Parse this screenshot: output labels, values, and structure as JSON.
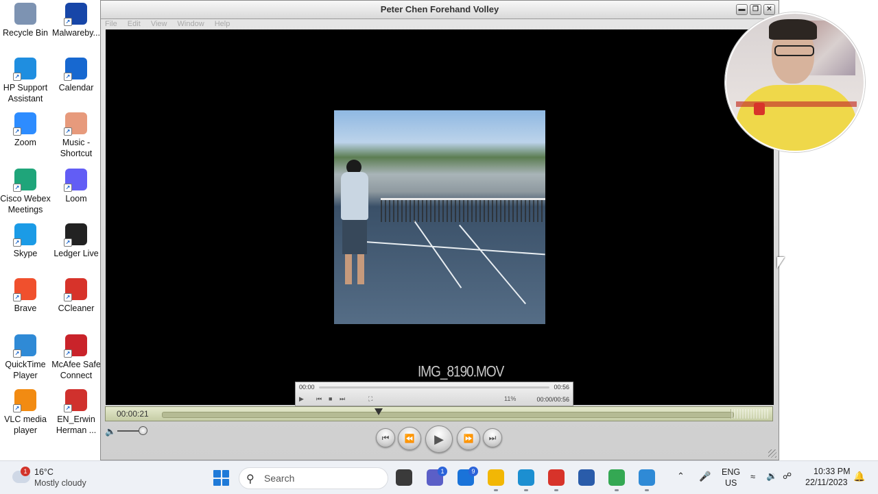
{
  "desktop": {
    "icons": [
      {
        "label": "Recycle Bin",
        "icon": "recycle-bin-icon",
        "color": "#7d93b2"
      },
      {
        "label": "Malwareby...",
        "icon": "malwarebytes-icon",
        "color": "#1746a8"
      },
      {
        "label": "HP Support Assistant",
        "icon": "hp-support-icon",
        "color": "#1f8ee0"
      },
      {
        "label": "Calendar",
        "icon": "calendar-icon",
        "color": "#1768d0"
      },
      {
        "label": "Zoom",
        "icon": "zoom-icon",
        "color": "#2d8cff"
      },
      {
        "label": "Music - Shortcut",
        "icon": "music-folder-icon",
        "color": "#e79a7c"
      },
      {
        "label": "Cisco Webex Meetings",
        "icon": "webex-icon",
        "color": "#1fa57a"
      },
      {
        "label": "Loom",
        "icon": "loom-icon",
        "color": "#625df5"
      },
      {
        "label": "Skype",
        "icon": "skype-icon",
        "color": "#1b9be6"
      },
      {
        "label": "Ledger Live",
        "icon": "ledger-icon",
        "color": "#222222"
      },
      {
        "label": "Brave",
        "icon": "brave-icon",
        "color": "#f0502d"
      },
      {
        "label": "CCleaner",
        "icon": "ccleaner-icon",
        "color": "#d7332a"
      },
      {
        "label": "QuickTime Player",
        "icon": "quicktime-icon",
        "color": "#2f8ad6"
      },
      {
        "label": "McAfee Safe Connect",
        "icon": "mcafee-icon",
        "color": "#c9232a"
      },
      {
        "label": "VLC media player",
        "icon": "vlc-icon",
        "color": "#f28b12"
      },
      {
        "label": "EN_Erwin Herman ...",
        "icon": "pdf-icon",
        "color": "#d0312d"
      }
    ]
  },
  "quicktime": {
    "title": "Peter Chen Forehand Volley",
    "menu": [
      "File",
      "Edit",
      "View",
      "Window",
      "Help"
    ],
    "video_caption": "IMG_8190.MOV",
    "mini_player": {
      "time_start": "00:00",
      "time_end": "00:56",
      "total": "00:00/00:56",
      "zoom": "11%"
    },
    "scrub": {
      "current_time": "00:00:21",
      "progress": 0.38
    },
    "volume_level": 0.85,
    "controls": [
      "go-to-start",
      "rewind",
      "play",
      "fast-forward",
      "go-to-end"
    ]
  },
  "taskbar": {
    "weather": {
      "temp": "16°C",
      "desc": "Mostly cloudy",
      "alert": "1"
    },
    "search_placeholder": "Search",
    "apps": [
      {
        "name": "file-explorer-dark-icon",
        "color": "#3a3a3a",
        "badge": ""
      },
      {
        "name": "teams-chat-icon",
        "color": "#5b5fc7",
        "badge": "1"
      },
      {
        "name": "mail-icon",
        "color": "#1a73d9",
        "badge": "9"
      },
      {
        "name": "folder-icon",
        "color": "#f2b705",
        "badge": ""
      },
      {
        "name": "edge-icon",
        "color": "#1c8fd1",
        "badge": ""
      },
      {
        "name": "ccleaner-taskbar-icon",
        "color": "#d7332a",
        "badge": ""
      },
      {
        "name": "window-app-icon",
        "color": "#2a5caa",
        "badge": ""
      },
      {
        "name": "chrome-icon",
        "color": "#34a853",
        "badge": ""
      },
      {
        "name": "quicktime-taskbar-icon",
        "color": "#2f8ad6",
        "badge": ""
      }
    ],
    "language": {
      "line1": "ENG",
      "line2": "US"
    },
    "clock": {
      "time": "10:33 PM",
      "date": "22/11/2023"
    }
  }
}
